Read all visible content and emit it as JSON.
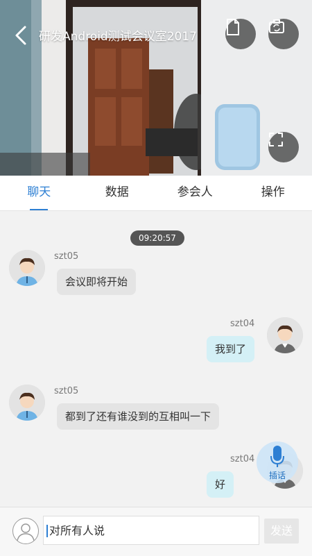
{
  "header": {
    "title": "研发Android测试会议室2017"
  },
  "video_controls": {
    "doc_icon": "document-icon",
    "camera_icon": "camera-switch-icon",
    "fullscreen_icon": "fullscreen-icon"
  },
  "tabs": [
    {
      "label": "聊天",
      "active": true
    },
    {
      "label": "数据",
      "active": false
    },
    {
      "label": "参会人",
      "active": false
    },
    {
      "label": "操作",
      "active": false
    }
  ],
  "chat": {
    "timestamp": "09:20:57",
    "messages": [
      {
        "sender": "szt05",
        "text": "会议即将开始",
        "side": "left"
      },
      {
        "sender": "szt04",
        "text": "我到了",
        "side": "right"
      },
      {
        "sender": "szt05",
        "text": "都到了还有谁没到的互相叫一下",
        "side": "left"
      },
      {
        "sender": "szt04",
        "text": "好",
        "side": "right"
      }
    ]
  },
  "mic": {
    "label": "插话"
  },
  "input": {
    "placeholder": "对所有人说"
  },
  "send": {
    "label": "发送"
  },
  "colors": {
    "accent": "#2d7fd3",
    "bubble_self": "#d4f0f6",
    "bubble_other": "#e4e4e4"
  }
}
